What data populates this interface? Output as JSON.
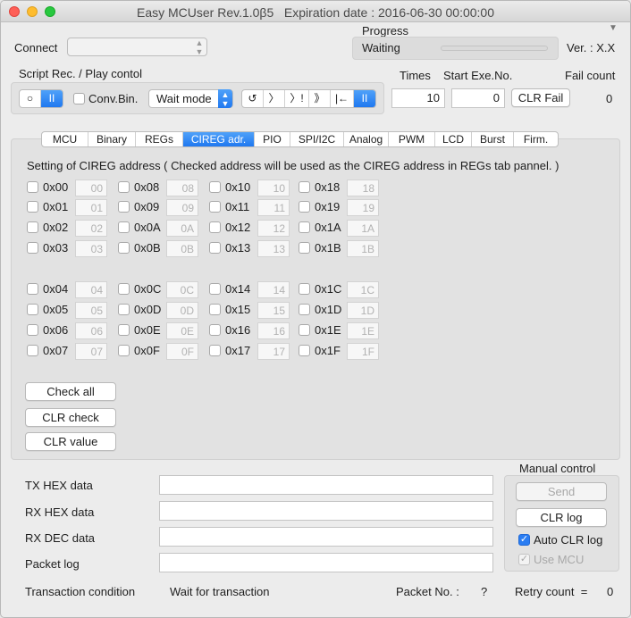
{
  "window": {
    "title": "Easy MCUser Rev.1.0β5   Expiration date : 2016-06-30 00:00:00"
  },
  "connect": {
    "label": "Connect",
    "selected": ""
  },
  "progress": {
    "label": "Progress",
    "status": "Waiting",
    "value": 0,
    "disclosure": "▼"
  },
  "version": "Ver. : X.X",
  "script": {
    "label": "Script Rec. / Play contol",
    "rec_play": [
      "○",
      "II"
    ],
    "conv_bin_label": "Conv.Bin.",
    "wait_mode": "Wait mode",
    "controls": [
      "↺",
      "〉",
      "〉!",
      "》",
      "|←",
      "II"
    ],
    "times_label": "Times",
    "times_value": "10",
    "start_label": "Start Exe.No.",
    "start_value": "0",
    "clr_fail": "CLR Fail",
    "fail_label": "Fail count",
    "fail_value": "0"
  },
  "tabs": [
    {
      "label": "MCU",
      "w": 0
    },
    {
      "label": "Binary"
    },
    {
      "label": "REGs"
    },
    {
      "label": "CIREG adr."
    },
    {
      "label": "PIO"
    },
    {
      "label": "SPI/I2C"
    },
    {
      "label": "Analog"
    },
    {
      "label": "PWM"
    },
    {
      "label": "LCD"
    },
    {
      "label": "Burst"
    },
    {
      "label": "Firm."
    }
  ],
  "active_tab": "CIREG adr.",
  "cireg": {
    "heading": "Setting of CIREG address ( Checked address will be used as the CIREG address in REGs tab pannel. )",
    "addresses": [
      [
        "0x00",
        "00"
      ],
      [
        "0x01",
        "01"
      ],
      [
        "0x02",
        "02"
      ],
      [
        "0x03",
        "03"
      ],
      [
        "0x04",
        "04"
      ],
      [
        "0x05",
        "05"
      ],
      [
        "0x06",
        "06"
      ],
      [
        "0x07",
        "07"
      ],
      [
        "0x08",
        "08"
      ],
      [
        "0x09",
        "09"
      ],
      [
        "0x0A",
        "0A"
      ],
      [
        "0x0B",
        "0B"
      ],
      [
        "0x0C",
        "0C"
      ],
      [
        "0x0D",
        "0D"
      ],
      [
        "0x0E",
        "0E"
      ],
      [
        "0x0F",
        "0F"
      ],
      [
        "0x10",
        "10"
      ],
      [
        "0x11",
        "11"
      ],
      [
        "0x12",
        "12"
      ],
      [
        "0x13",
        "13"
      ],
      [
        "0x14",
        "14"
      ],
      [
        "0x15",
        "15"
      ],
      [
        "0x16",
        "16"
      ],
      [
        "0x17",
        "17"
      ],
      [
        "0x18",
        "18"
      ],
      [
        "0x19",
        "19"
      ],
      [
        "0x1A",
        "1A"
      ],
      [
        "0x1B",
        "1B"
      ],
      [
        "0x1C",
        "1C"
      ],
      [
        "0x1D",
        "1D"
      ],
      [
        "0x1E",
        "1E"
      ],
      [
        "0x1F",
        "1F"
      ]
    ],
    "check_all": "Check all",
    "clr_check": "CLR check",
    "clr_value": "CLR value"
  },
  "data_fields": [
    {
      "label": "TX HEX data",
      "value": ""
    },
    {
      "label": "RX HEX data",
      "value": ""
    },
    {
      "label": "RX DEC data",
      "value": ""
    },
    {
      "label": "Packet log",
      "value": ""
    }
  ],
  "manual": {
    "label": "Manual control",
    "send": "Send",
    "clr_log": "CLR log",
    "auto_clr_log": "Auto CLR log",
    "use_mcu": "Use MCU",
    "check_mark": "✓"
  },
  "status": {
    "transaction_label": "Transaction condition",
    "transaction_value": "Wait for transaction",
    "packet_label": "Packet No. :",
    "packet_value": "?",
    "retry_label": "Retry count  =",
    "retry_value": "0"
  },
  "colors": {
    "accent": "#2a7df2",
    "window_bg": "#ececec"
  }
}
